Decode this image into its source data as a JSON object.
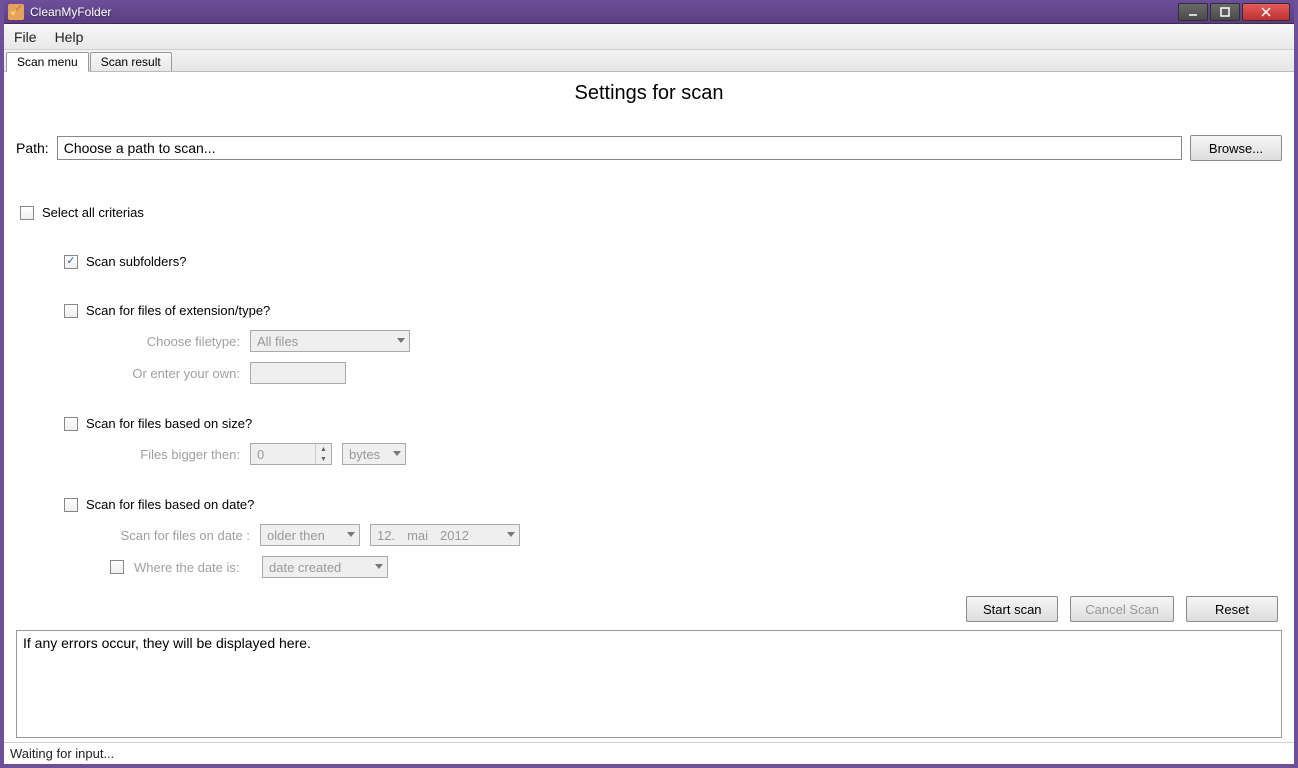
{
  "window": {
    "title": "CleanMyFolder"
  },
  "menu": {
    "file": "File",
    "help": "Help"
  },
  "tabs": {
    "scan_menu": "Scan menu",
    "scan_result": "Scan result"
  },
  "page_title": "Settings for scan",
  "path": {
    "label": "Path:",
    "value": "Choose a path to scan...",
    "browse": "Browse..."
  },
  "criteria": {
    "select_all": "Select all criterias",
    "scan_subfolders": "Scan subfolders?",
    "scan_extension": {
      "label": "Scan for files of extension/type?",
      "choose_label": "Choose filetype:",
      "choose_value": "All files",
      "own_label": "Or enter your own:",
      "own_value": ""
    },
    "scan_size": {
      "label": "Scan for files based on size?",
      "bigger_label": "Files bigger then:",
      "bigger_value": "0",
      "unit": "bytes"
    },
    "scan_date": {
      "label": "Scan for files based on date?",
      "on_date_label": "Scan for files on date :",
      "mode": "older then",
      "day": "12.",
      "month": "mai",
      "year": "2012",
      "where_label": "Where the date is:",
      "where_value": "date created"
    }
  },
  "buttons": {
    "start": "Start scan",
    "cancel": "Cancel Scan",
    "reset": "Reset"
  },
  "errors": {
    "placeholder": "If any errors occur, they will be displayed here."
  },
  "status": "Waiting for input..."
}
